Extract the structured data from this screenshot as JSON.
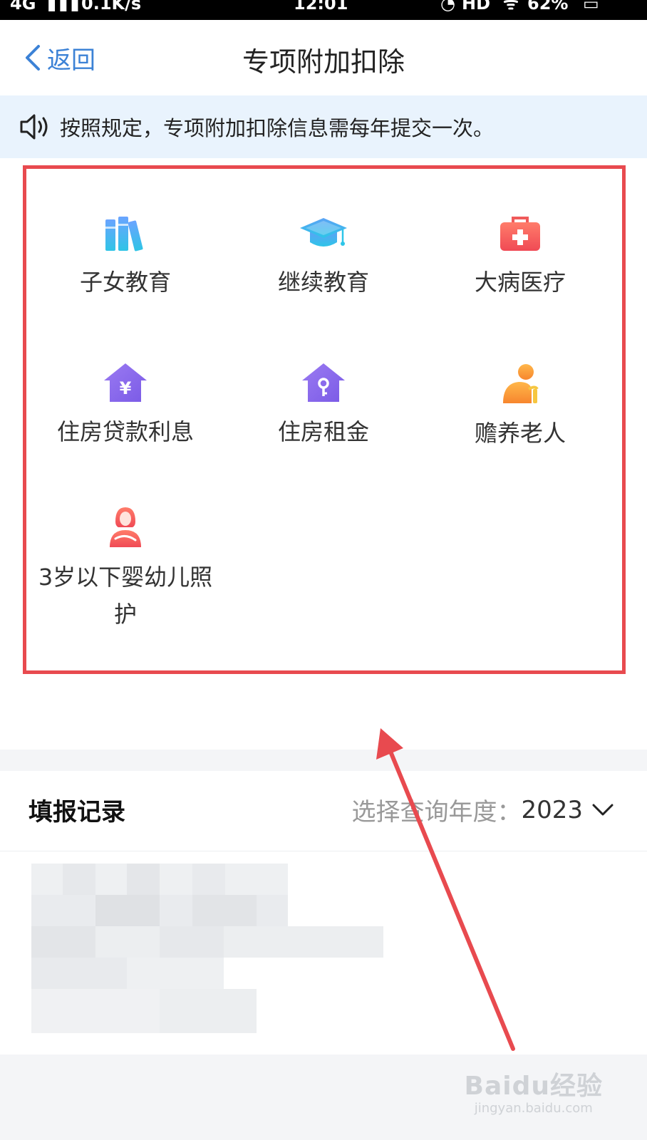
{
  "status_bar": {
    "network": "4G",
    "speed": "0.1K/s",
    "time": "12:01",
    "hd": "HD",
    "battery": "62%"
  },
  "nav": {
    "back_label": "返回",
    "title": "专项附加扣除"
  },
  "notice": {
    "text": "按照规定，专项附加扣除信息需每年提交一次。"
  },
  "deduction_items": [
    {
      "label": "子女教育",
      "icon": "books-icon"
    },
    {
      "label": "继续教育",
      "icon": "graduation-cap-icon"
    },
    {
      "label": "大病医疗",
      "icon": "medical-kit-icon"
    },
    {
      "label": "住房贷款利息",
      "icon": "house-yuan-icon"
    },
    {
      "label": "住房租金",
      "icon": "house-key-icon"
    },
    {
      "label": "赡养老人",
      "icon": "elderly-icon"
    },
    {
      "label": "3岁以下婴幼儿照护",
      "icon": "mother-baby-icon"
    }
  ],
  "records": {
    "title": "填报记录",
    "year_label": "选择查询年度：",
    "year_value": "2023"
  },
  "watermark": {
    "main": "Baidu经验",
    "sub": "jingyan.baidu.com"
  },
  "colors": {
    "accent_blue": "#3c82d6",
    "notice_bg": "#e9f3fd",
    "highlight_red": "#e84a4f",
    "icon_purple": "#8c6bea",
    "icon_red": "#f0565a",
    "icon_orange": "#f7a838"
  }
}
